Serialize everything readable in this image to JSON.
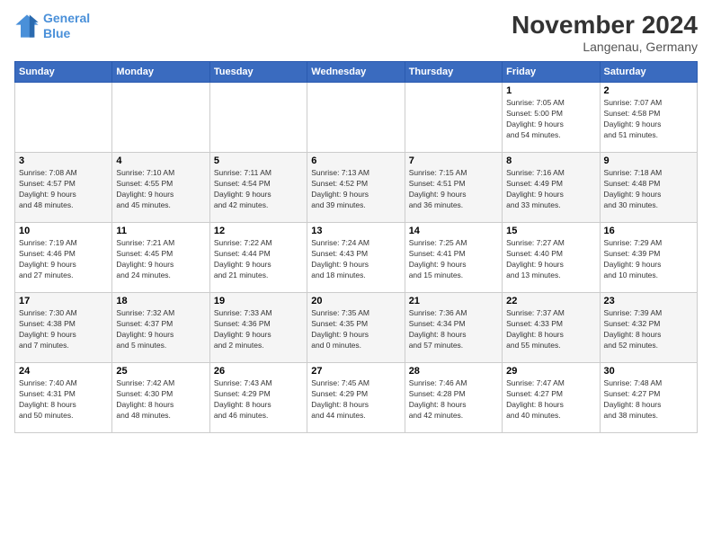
{
  "header": {
    "logo_line1": "General",
    "logo_line2": "Blue",
    "title": "November 2024",
    "subtitle": "Langenau, Germany"
  },
  "weekdays": [
    "Sunday",
    "Monday",
    "Tuesday",
    "Wednesday",
    "Thursday",
    "Friday",
    "Saturday"
  ],
  "weeks": [
    [
      {
        "day": "",
        "info": ""
      },
      {
        "day": "",
        "info": ""
      },
      {
        "day": "",
        "info": ""
      },
      {
        "day": "",
        "info": ""
      },
      {
        "day": "",
        "info": ""
      },
      {
        "day": "1",
        "info": "Sunrise: 7:05 AM\nSunset: 5:00 PM\nDaylight: 9 hours\nand 54 minutes."
      },
      {
        "day": "2",
        "info": "Sunrise: 7:07 AM\nSunset: 4:58 PM\nDaylight: 9 hours\nand 51 minutes."
      }
    ],
    [
      {
        "day": "3",
        "info": "Sunrise: 7:08 AM\nSunset: 4:57 PM\nDaylight: 9 hours\nand 48 minutes."
      },
      {
        "day": "4",
        "info": "Sunrise: 7:10 AM\nSunset: 4:55 PM\nDaylight: 9 hours\nand 45 minutes."
      },
      {
        "day": "5",
        "info": "Sunrise: 7:11 AM\nSunset: 4:54 PM\nDaylight: 9 hours\nand 42 minutes."
      },
      {
        "day": "6",
        "info": "Sunrise: 7:13 AM\nSunset: 4:52 PM\nDaylight: 9 hours\nand 39 minutes."
      },
      {
        "day": "7",
        "info": "Sunrise: 7:15 AM\nSunset: 4:51 PM\nDaylight: 9 hours\nand 36 minutes."
      },
      {
        "day": "8",
        "info": "Sunrise: 7:16 AM\nSunset: 4:49 PM\nDaylight: 9 hours\nand 33 minutes."
      },
      {
        "day": "9",
        "info": "Sunrise: 7:18 AM\nSunset: 4:48 PM\nDaylight: 9 hours\nand 30 minutes."
      }
    ],
    [
      {
        "day": "10",
        "info": "Sunrise: 7:19 AM\nSunset: 4:46 PM\nDaylight: 9 hours\nand 27 minutes."
      },
      {
        "day": "11",
        "info": "Sunrise: 7:21 AM\nSunset: 4:45 PM\nDaylight: 9 hours\nand 24 minutes."
      },
      {
        "day": "12",
        "info": "Sunrise: 7:22 AM\nSunset: 4:44 PM\nDaylight: 9 hours\nand 21 minutes."
      },
      {
        "day": "13",
        "info": "Sunrise: 7:24 AM\nSunset: 4:43 PM\nDaylight: 9 hours\nand 18 minutes."
      },
      {
        "day": "14",
        "info": "Sunrise: 7:25 AM\nSunset: 4:41 PM\nDaylight: 9 hours\nand 15 minutes."
      },
      {
        "day": "15",
        "info": "Sunrise: 7:27 AM\nSunset: 4:40 PM\nDaylight: 9 hours\nand 13 minutes."
      },
      {
        "day": "16",
        "info": "Sunrise: 7:29 AM\nSunset: 4:39 PM\nDaylight: 9 hours\nand 10 minutes."
      }
    ],
    [
      {
        "day": "17",
        "info": "Sunrise: 7:30 AM\nSunset: 4:38 PM\nDaylight: 9 hours\nand 7 minutes."
      },
      {
        "day": "18",
        "info": "Sunrise: 7:32 AM\nSunset: 4:37 PM\nDaylight: 9 hours\nand 5 minutes."
      },
      {
        "day": "19",
        "info": "Sunrise: 7:33 AM\nSunset: 4:36 PM\nDaylight: 9 hours\nand 2 minutes."
      },
      {
        "day": "20",
        "info": "Sunrise: 7:35 AM\nSunset: 4:35 PM\nDaylight: 9 hours\nand 0 minutes."
      },
      {
        "day": "21",
        "info": "Sunrise: 7:36 AM\nSunset: 4:34 PM\nDaylight: 8 hours\nand 57 minutes."
      },
      {
        "day": "22",
        "info": "Sunrise: 7:37 AM\nSunset: 4:33 PM\nDaylight: 8 hours\nand 55 minutes."
      },
      {
        "day": "23",
        "info": "Sunrise: 7:39 AM\nSunset: 4:32 PM\nDaylight: 8 hours\nand 52 minutes."
      }
    ],
    [
      {
        "day": "24",
        "info": "Sunrise: 7:40 AM\nSunset: 4:31 PM\nDaylight: 8 hours\nand 50 minutes."
      },
      {
        "day": "25",
        "info": "Sunrise: 7:42 AM\nSunset: 4:30 PM\nDaylight: 8 hours\nand 48 minutes."
      },
      {
        "day": "26",
        "info": "Sunrise: 7:43 AM\nSunset: 4:29 PM\nDaylight: 8 hours\nand 46 minutes."
      },
      {
        "day": "27",
        "info": "Sunrise: 7:45 AM\nSunset: 4:29 PM\nDaylight: 8 hours\nand 44 minutes."
      },
      {
        "day": "28",
        "info": "Sunrise: 7:46 AM\nSunset: 4:28 PM\nDaylight: 8 hours\nand 42 minutes."
      },
      {
        "day": "29",
        "info": "Sunrise: 7:47 AM\nSunset: 4:27 PM\nDaylight: 8 hours\nand 40 minutes."
      },
      {
        "day": "30",
        "info": "Sunrise: 7:48 AM\nSunset: 4:27 PM\nDaylight: 8 hours\nand 38 minutes."
      }
    ]
  ]
}
